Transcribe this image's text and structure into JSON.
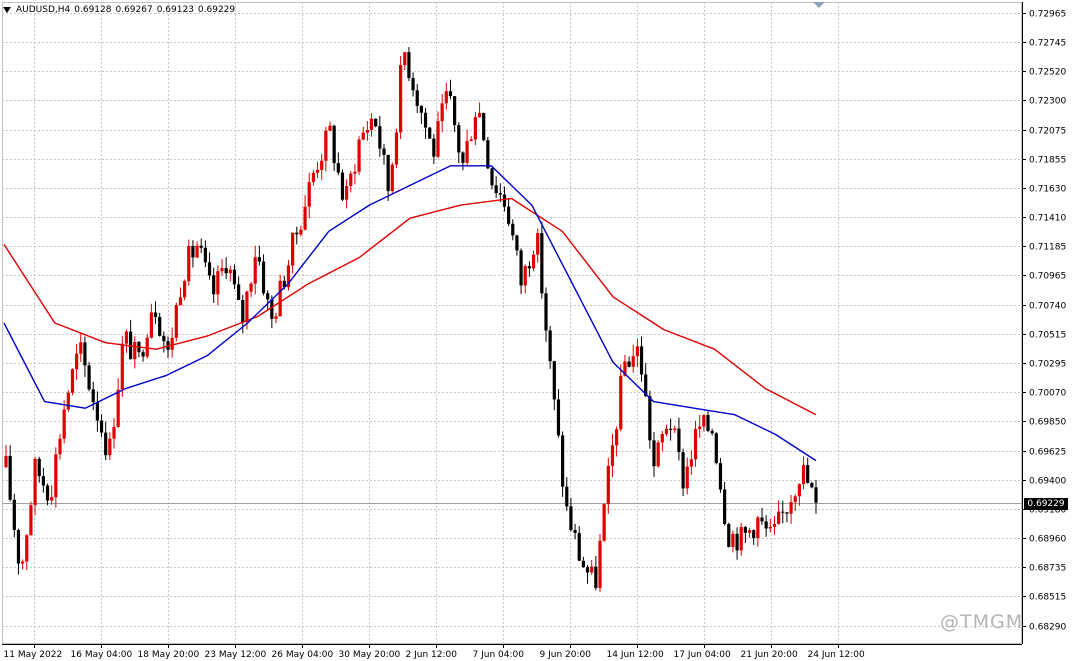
{
  "header": {
    "symbol": "AUDUSD,H4",
    "open": "0.69128",
    "high": "0.69267",
    "low": "0.69123",
    "close": "0.69229"
  },
  "current_price_label": "0.69229",
  "watermark": "@TMGM",
  "colors": {
    "bull_candle": "#e00000",
    "bear_candle": "#000000",
    "ma_fast": "#0000c8",
    "ma_slow": "#e00000",
    "grid": "#c8c8c8",
    "price_tag_bg": "#000000"
  },
  "chart_data": {
    "type": "candlestick",
    "title": "AUDUSD,H4",
    "ylim": [
      0.6815,
      0.7305
    ],
    "grid": true,
    "x_tick_labels": [
      "11 May 2022",
      "16 May 04:00",
      "18 May 20:00",
      "23 May 12:00",
      "26 May 04:00",
      "30 May 20:00",
      "2 Jun 12:00",
      "7 Jun 04:00",
      "9 Jun 20:00",
      "14 Jun 12:00",
      "17 Jun 04:00",
      "21 Jun 20:00",
      "24 Jun 12:00"
    ],
    "y_tick_labels": [
      "0.72965",
      "0.72745",
      "0.72520",
      "0.72300",
      "0.72075",
      "0.71855",
      "0.71630",
      "0.71410",
      "0.71185",
      "0.70965",
      "0.70740",
      "0.70515",
      "0.70295",
      "0.70070",
      "0.69850",
      "0.69625",
      "0.69400",
      "0.69180",
      "0.68960",
      "0.68735",
      "0.68515",
      "0.68290"
    ],
    "y_tick_values": [
      0.72965,
      0.72745,
      0.7252,
      0.723,
      0.72075,
      0.71855,
      0.7163,
      0.7141,
      0.71185,
      0.70965,
      0.7074,
      0.70515,
      0.70295,
      0.7007,
      0.6985,
      0.69625,
      0.694,
      0.6918,
      0.6896,
      0.68735,
      0.68515,
      0.6829
    ],
    "close_path": [
      0.695,
      0.687,
      0.695,
      0.693,
      0.7,
      0.704,
      0.7,
      0.696,
      0.705,
      0.703,
      0.708,
      0.7035,
      0.71,
      0.712,
      0.708,
      0.711,
      0.706,
      0.712,
      0.706,
      0.71,
      0.714,
      0.718,
      0.7205,
      0.715,
      0.72,
      0.722,
      0.716,
      0.727,
      0.723,
      0.719,
      0.7235,
      0.718,
      0.723,
      0.717,
      0.715,
      0.709,
      0.713,
      0.702,
      0.692,
      0.688,
      0.686,
      0.695,
      0.703,
      0.704,
      0.695,
      0.699,
      0.694,
      0.698,
      0.698,
      0.69,
      0.6895,
      0.691,
      0.6895,
      0.692,
      0.695,
      0.69229
    ],
    "ma_fast": [
      0.706,
      0.7,
      0.6995,
      0.701,
      0.702,
      0.7035,
      0.706,
      0.709,
      0.713,
      0.715,
      0.7165,
      0.718,
      0.718,
      0.715,
      0.709,
      0.703,
      0.7,
      0.6995,
      0.699,
      0.6975,
      0.6955
    ],
    "ma_slow": [
      0.712,
      0.706,
      0.7045,
      0.704,
      0.705,
      0.7065,
      0.709,
      0.711,
      0.714,
      0.715,
      0.7155,
      0.713,
      0.708,
      0.7055,
      0.704,
      0.701,
      0.699
    ],
    "series": [
      {
        "name": "",
        "values": "ma_fast"
      },
      {
        "name": "",
        "values": "ma_slow"
      }
    ]
  }
}
